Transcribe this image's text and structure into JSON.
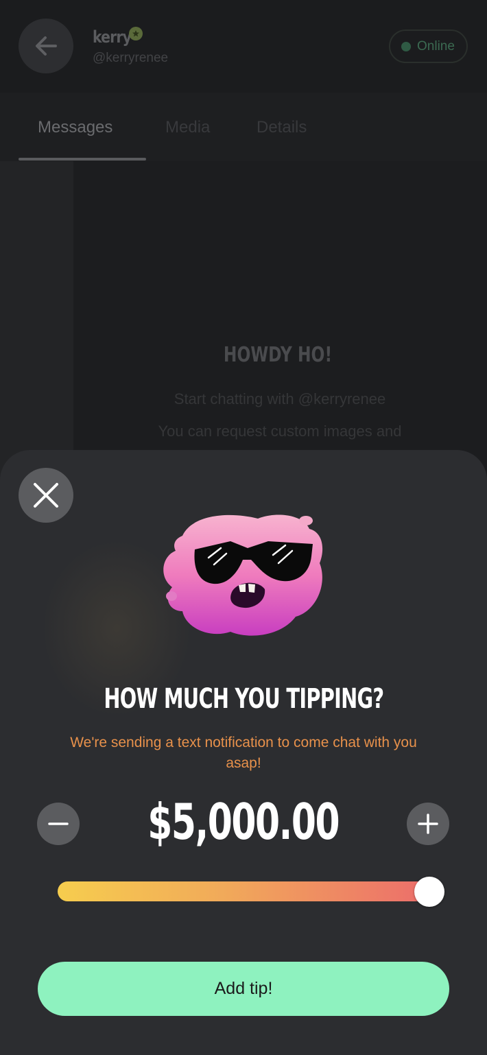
{
  "header": {
    "user_name": "kerry",
    "user_handle": "@kerryrenee",
    "status_label": "Online",
    "back_icon": "arrow-left-icon",
    "verified_icon": "verified-badge-icon"
  },
  "tabs": [
    {
      "label": "Messages",
      "active": true
    },
    {
      "label": "Media",
      "active": false
    },
    {
      "label": "Details",
      "active": false
    }
  ],
  "chat": {
    "greeting": "HOWDY HO!",
    "start_text": "Start chatting with @kerryrenee",
    "request_text": "You can request custom images and"
  },
  "tip_modal": {
    "close_icon": "close-icon",
    "mascot": "pink-blob-sunglasses-mascot",
    "title": "HOW MUCH YOU TIPPING?",
    "subtitle": "We're sending a text notification to come chat with you asap!",
    "amount": "$5,000.00",
    "slider_level": 1.0,
    "minus_icon": "minus-icon",
    "plus_icon": "plus-icon",
    "submit_label": "Add tip!",
    "colors": {
      "accent_green": "#8ef2bf",
      "subtitle_orange": "#e8914b",
      "slider_start": "#f6cd4e",
      "slider_end": "#ec6d6b"
    }
  }
}
